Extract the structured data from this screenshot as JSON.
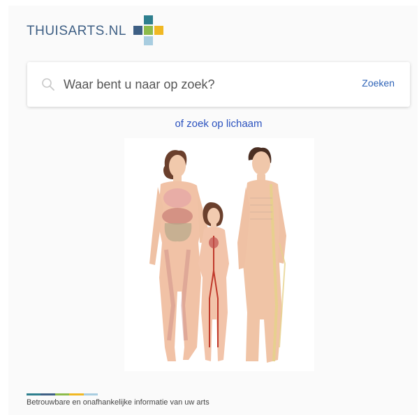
{
  "brand": {
    "logo_text": "THUISARTS.NL",
    "colors": {
      "text": "#3e5f84",
      "cross_top": "#2e7f8e",
      "cross_left": "#3e5f84",
      "cross_center": "#8dbb4a",
      "cross_right": "#f0b823",
      "cross_bottom": "#a8cde0"
    }
  },
  "search": {
    "placeholder": "Waar bent u naar op zoek?",
    "value": "",
    "button_label": "Zoeken",
    "icon": "search-icon"
  },
  "body_search": {
    "link_label": "of zoek op lichaam",
    "image": "human-body-anatomy-figures"
  },
  "footer": {
    "bar_colors": [
      "#2e7f8e",
      "#3e5f84",
      "#8dbb4a",
      "#f0b823",
      "#a8cde0"
    ],
    "tagline": "Betrouwbare en onafhankelijke informatie van uw arts"
  }
}
